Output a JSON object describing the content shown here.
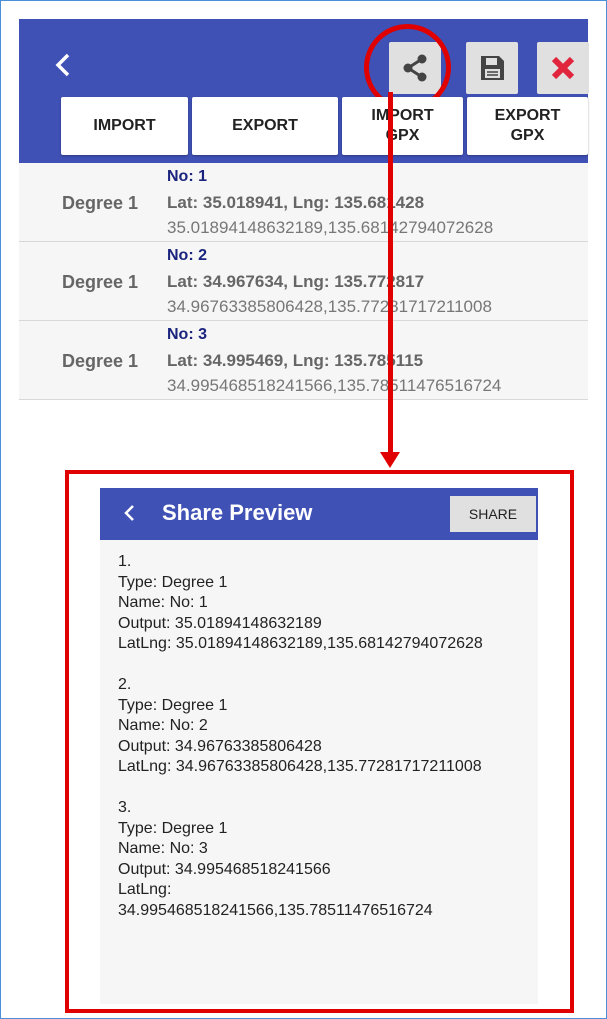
{
  "toolbar": {
    "back_icon": "chevron-left-icon",
    "share_icon": "share-icon",
    "save_icon": "floppy-disk-icon",
    "close_icon": "close-x-icon",
    "primary_color": "#3f51b5",
    "close_color": "#e0253c"
  },
  "actions": {
    "import_label": "IMPORT",
    "export_label": "EXPORT",
    "import_gpx_label": "IMPORT\nGPX",
    "export_gpx_label": "EXPORT\nGPX"
  },
  "points": [
    {
      "type": "Degree 1",
      "name": "No: 1",
      "latlng": "Lat: 35.018941, Lng: 135.681428",
      "raw": "35.01894148632189,135.68142794072628"
    },
    {
      "type": "Degree 1",
      "name": "No: 2",
      "latlng": "Lat: 34.967634, Lng: 135.772817",
      "raw": "34.96763385806428,135.77281717211008"
    },
    {
      "type": "Degree 1",
      "name": "No: 3",
      "latlng": "Lat: 34.995469, Lng: 135.785115",
      "raw": "34.995468518241566,135.78511476516724"
    }
  ],
  "preview": {
    "back_icon": "chevron-left-icon",
    "title": "Share Preview",
    "share_label": "SHARE",
    "entries": [
      {
        "index": "1.",
        "type": "Type: Degree 1",
        "name": "Name: No: 1",
        "output": "Output: 35.01894148632189",
        "latlng": "LatLng: 35.01894148632189,135.68142794072628"
      },
      {
        "index": "2.",
        "type": "Type: Degree 1",
        "name": "Name: No: 2",
        "output": "Output: 34.96763385806428",
        "latlng": "LatLng: 34.96763385806428,135.77281717211008"
      },
      {
        "index": "3.",
        "type": "Type: Degree 1",
        "name": "Name: No: 3",
        "output": "Output: 34.995468518241566",
        "latlng": "LatLng:",
        "latlng_value": "34.995468518241566,135.78511476516724"
      }
    ]
  },
  "annotation": {
    "highlight_color": "#e00000"
  }
}
